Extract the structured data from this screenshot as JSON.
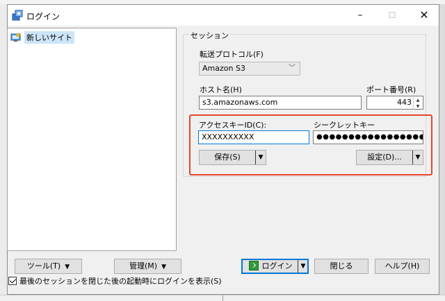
{
  "window": {
    "title": "ログイン",
    "minimize_glyph": "–",
    "maximize_glyph": "☐",
    "close_glyph": "✕"
  },
  "tree": {
    "items": [
      {
        "label": "新しいサイト",
        "icon": "new-site-icon",
        "selected": true
      }
    ]
  },
  "session": {
    "legend": "セッション",
    "protocol_label": "転送プロトコル(F)",
    "protocol_value": "Amazon S3",
    "host_label": "ホスト名(H)",
    "host_value": "s3.amazonaws.com",
    "port_label": "ポート番号(R)",
    "port_value": "443",
    "access_key_label": "アクセスキーID(C):",
    "access_key_value": "XXXXXXXXXX",
    "secret_key_label": "シークレットキー",
    "secret_key_value": "●●●●●●●●●●●●●●●●●●●●●●",
    "save_label": "保存(S)",
    "settings_label": "設定(D)..."
  },
  "bottom": {
    "tools_label": "ツール(T)",
    "manage_label": "管理(M)",
    "login_label": "ログイン",
    "close_label": "閉じる",
    "help_label": "ヘルプ(H)",
    "checkbox_label": "最後のセッションを閉じた後の起動時にログインを表示(S)",
    "checkbox_checked": true
  },
  "colors": {
    "highlight": "#e8442a",
    "focus": "#0078d7",
    "selection": "#cce4f7"
  }
}
